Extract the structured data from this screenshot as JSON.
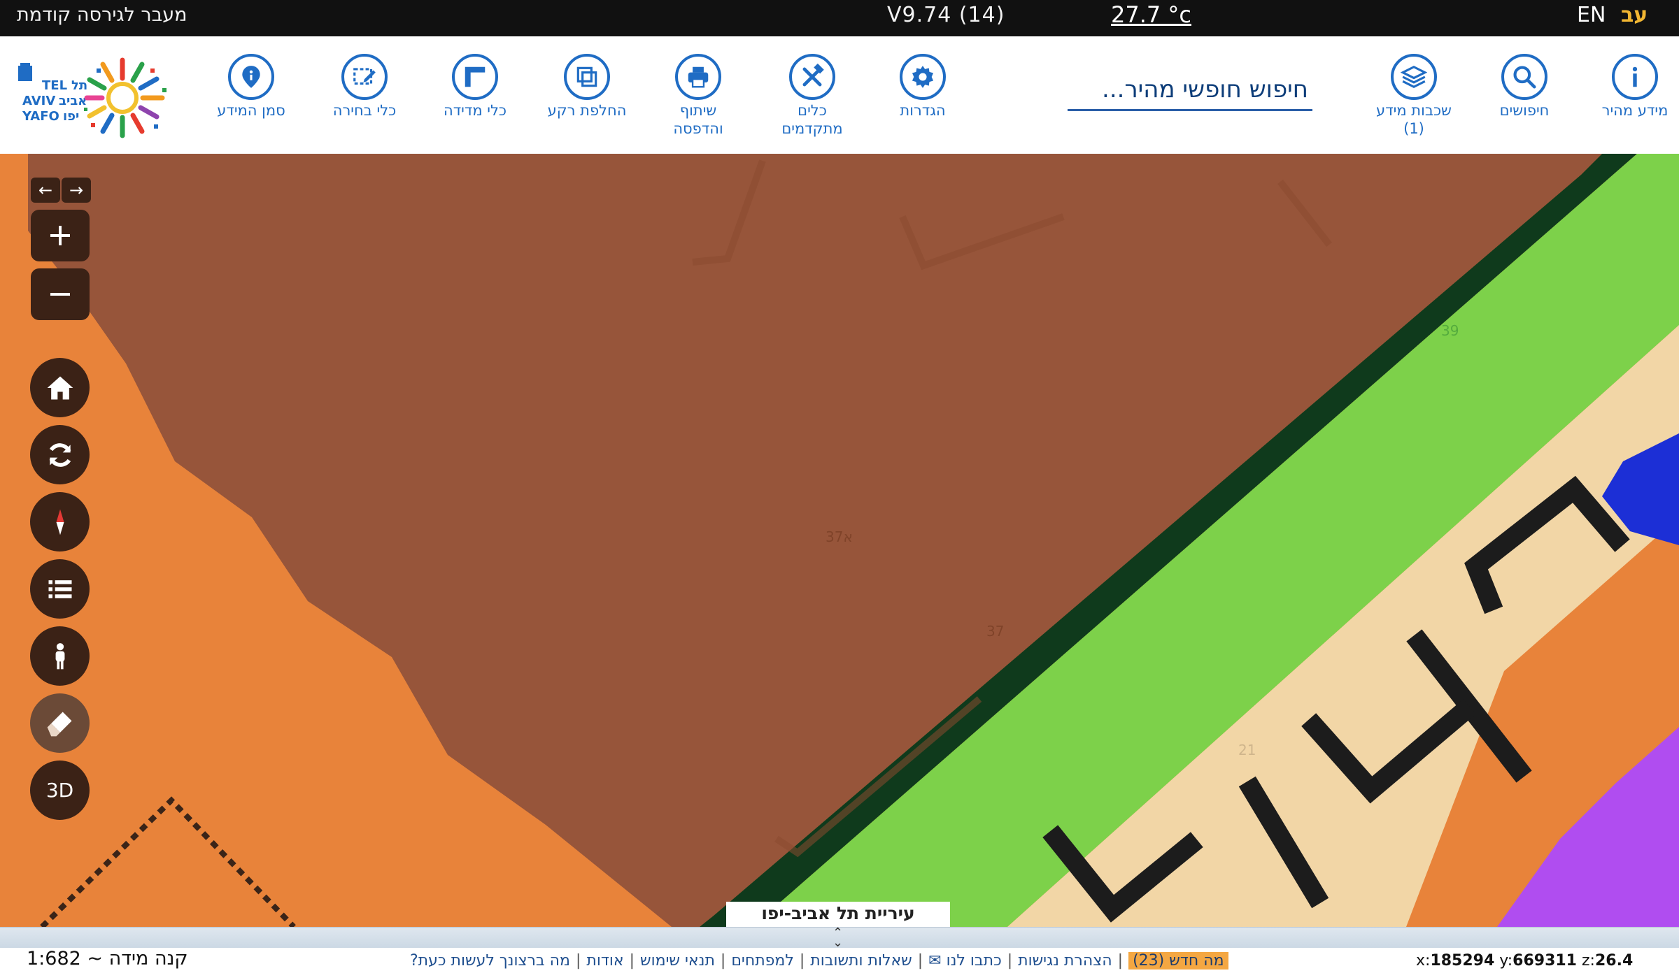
{
  "topbar": {
    "prev_version_link": "מעבר לגירסה קודמת",
    "version": "V9.74 (14)",
    "temperature": "27.7 °c",
    "lang_en": "EN",
    "lang_he": "עב"
  },
  "toolbar": {
    "tools": [
      {
        "label": "מידע מהיר",
        "icon": "info-icon"
      },
      {
        "label": "חיפושים",
        "icon": "search-icon"
      },
      {
        "label": "שכבות מידע\n(1)",
        "icon": "layers-icon"
      },
      {
        "label": "הגדרות",
        "icon": "gear-icon"
      },
      {
        "label": "כלים\nמתקדמים",
        "icon": "tools-icon"
      },
      {
        "label": "שיתוף\nוהדפסה",
        "icon": "printer-icon"
      },
      {
        "label": "החלפת רקע",
        "icon": "basemap-icon"
      },
      {
        "label": "כלי מדידה",
        "icon": "ruler-icon"
      },
      {
        "label": "כלי בחירה",
        "icon": "select-icon"
      },
      {
        "label": "סמן המידע",
        "icon": "pin-icon"
      }
    ],
    "search_placeholder": "חיפוש חופשי מהיר..."
  },
  "logo": {
    "text_en_1": "TEL",
    "text_en_2": "AVIV",
    "text_en_3": "YAFO",
    "text_he_1": "תל",
    "text_he_2": "אביב",
    "text_he_3": "יפו"
  },
  "map": {
    "label": "עיריית תל אביב-יפו",
    "controls": {
      "back": "←",
      "forward": "→",
      "zoom_in": "+",
      "zoom_out": "−",
      "btn_3d": "3D"
    },
    "colors": {
      "orange": "#e8833a",
      "brown": "#97553a",
      "green": "#7dd14a",
      "dark_green": "#0f3a1c",
      "beige": "#f2d6a6",
      "blue": "#1c2fd6",
      "purple": "#b04df0",
      "control_bg": "#3b2216"
    }
  },
  "footer": {
    "scale": "קנה מידה ~ 1:682",
    "links": [
      "מה ברצונך לעשות כעת?",
      "אודות",
      "תנאי שימוש",
      "למפתחים",
      "שאלות ותשובות",
      "כתבו לנו ✉",
      "הצהרת נגישות"
    ],
    "whats_new": "מה חדש (23)",
    "coords": {
      "x_label": "x:",
      "x": "185294",
      "y_label": "y:",
      "y": "669311",
      "z_label": "z:",
      "z": "26.4"
    }
  }
}
